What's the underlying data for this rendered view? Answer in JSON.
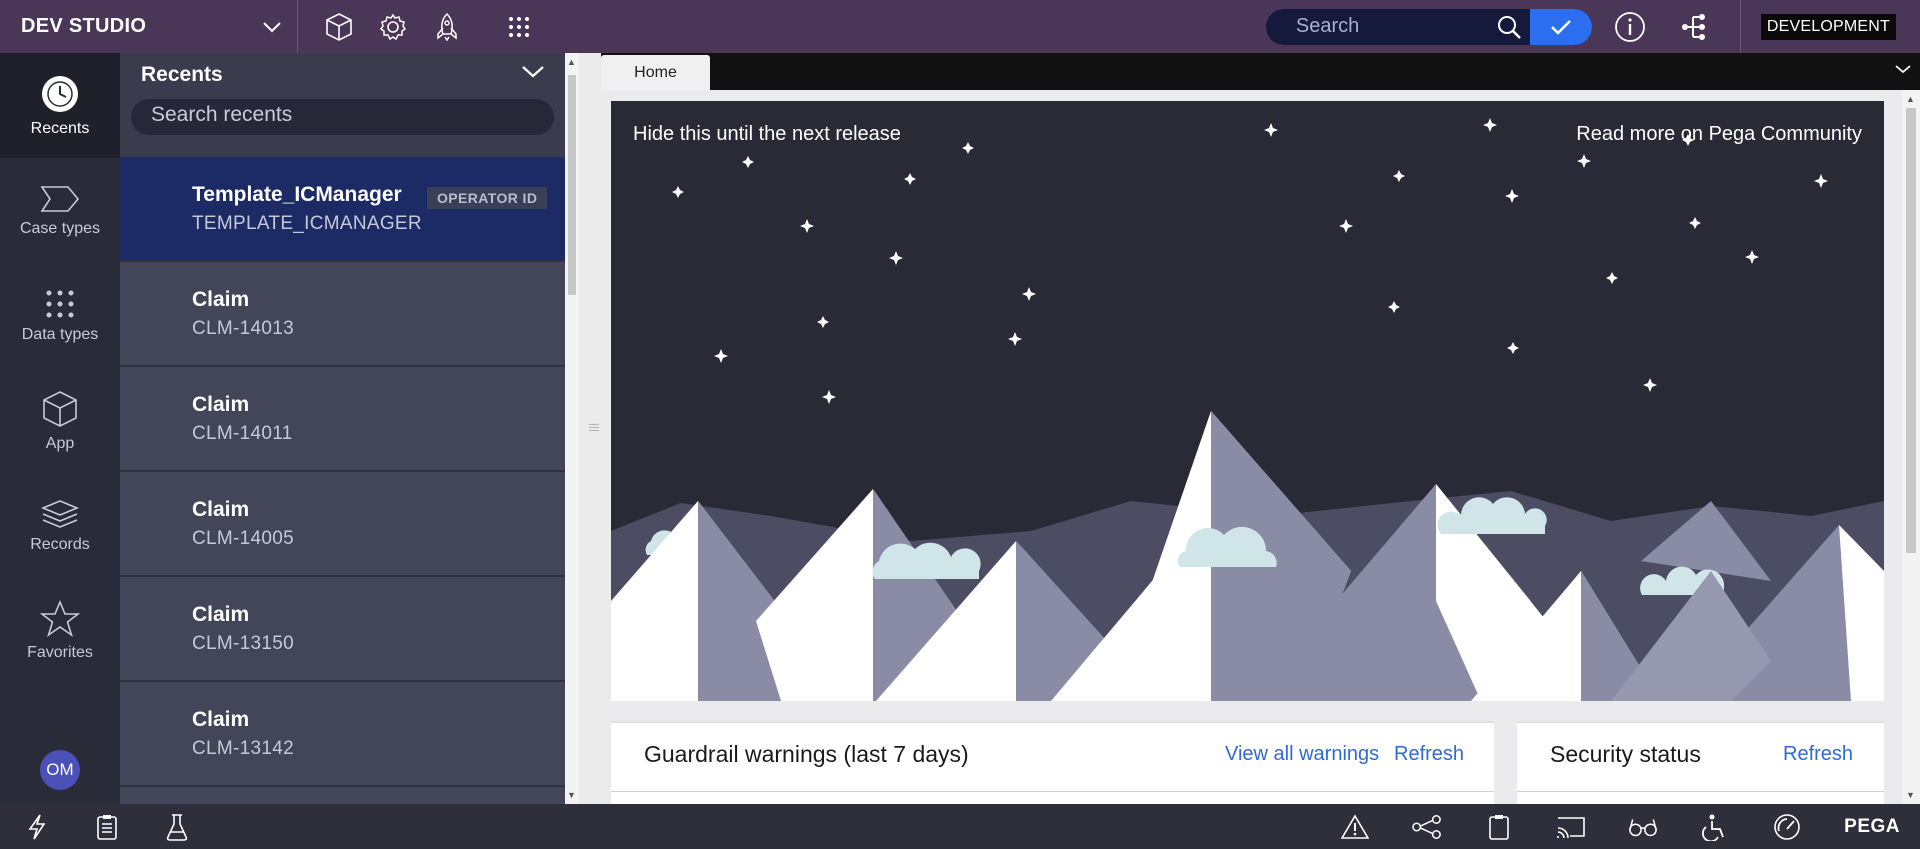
{
  "header": {
    "brand": "DEV STUDIO",
    "icons": [
      "cube-icon",
      "gear-icon",
      "rocket-icon",
      "app-grid-icon"
    ],
    "search_placeholder": "Search",
    "environment": "DEVELOPMENT",
    "accent": "#2b6ef0",
    "bar_color": "#4a3757"
  },
  "rail": {
    "items": [
      {
        "label": "Recents",
        "icon": "clock-icon"
      },
      {
        "label": "Case types",
        "icon": "case-type-icon"
      },
      {
        "label": "Data types",
        "icon": "data-type-icon"
      },
      {
        "label": "App",
        "icon": "cube-icon"
      },
      {
        "label": "Records",
        "icon": "layers-icon"
      },
      {
        "label": "Favorites",
        "icon": "star-icon"
      }
    ],
    "avatar": "OM"
  },
  "recents": {
    "title": "Recents",
    "search_placeholder": "Search recents",
    "items": [
      {
        "title": "Template_ICManager",
        "subtitle": "TEMPLATE_ICMANAGER",
        "badge": "OPERATOR ID"
      },
      {
        "title": "Claim",
        "subtitle": "CLM-14013"
      },
      {
        "title": "Claim",
        "subtitle": "CLM-14011"
      },
      {
        "title": "Claim",
        "subtitle": "CLM-14005"
      },
      {
        "title": "Claim",
        "subtitle": "CLM-13150"
      },
      {
        "title": "Claim",
        "subtitle": "CLM-13142"
      }
    ]
  },
  "main": {
    "tab": "Home",
    "banner": {
      "hide_link": "Hide this until the next release",
      "community_link": "Read more on Pega Community"
    },
    "cards": {
      "guardrail": {
        "title": "Guardrail warnings (last 7 days)",
        "view_all": "View all warnings",
        "refresh": "Refresh"
      },
      "security": {
        "title": "Security status",
        "refresh": "Refresh"
      }
    }
  },
  "footer": {
    "left_icons": [
      "lightning-icon",
      "clipboard-icon",
      "flask-icon"
    ],
    "right_icons": [
      "warning-icon",
      "branch-icon",
      "clipboard-check-icon",
      "cast-icon",
      "glasses-icon",
      "accessibility-icon",
      "gauge-icon"
    ],
    "logo": "PEGA"
  }
}
